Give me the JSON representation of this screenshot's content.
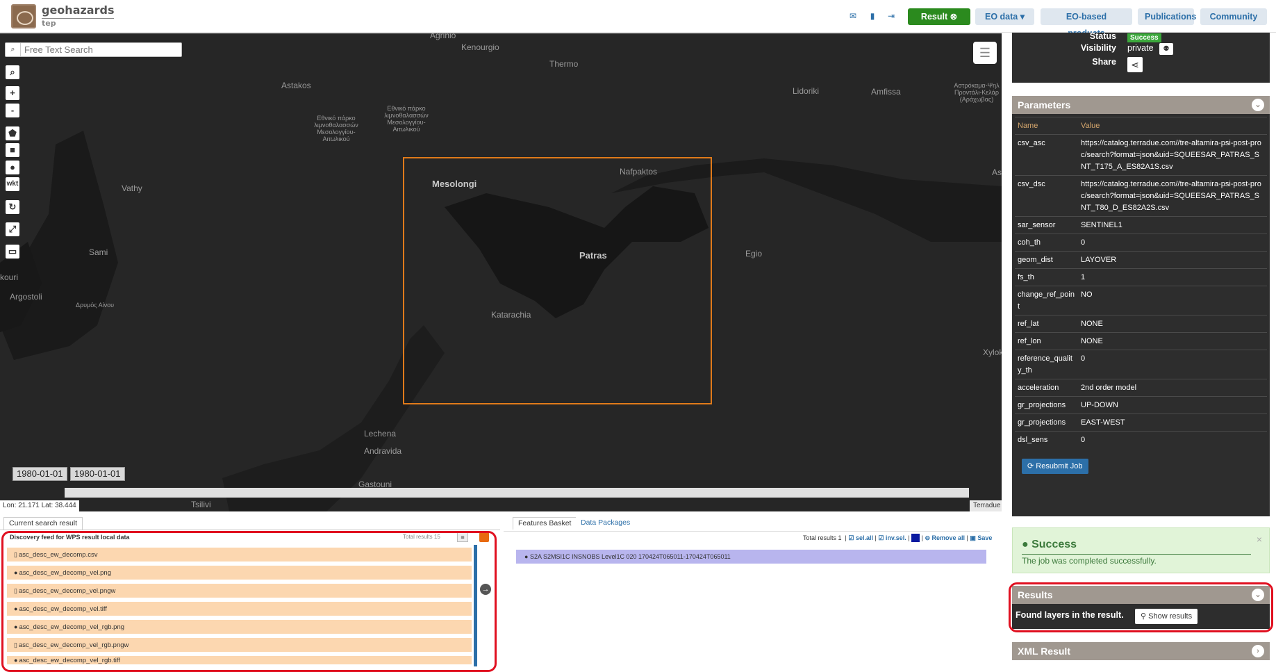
{
  "header": {
    "app_name": "geohazards",
    "app_sub": "tep",
    "icons": [
      "envelope-icon",
      "book-icon",
      "sign-out-icon"
    ],
    "nav": [
      {
        "label": "Result ⊗"
      },
      {
        "label": "EO data ▾"
      },
      {
        "label": "EO-based products"
      },
      {
        "label": "Publications"
      },
      {
        "label": "Community"
      }
    ]
  },
  "map": {
    "search_placeholder": "Free Text Search",
    "buttons": {
      "zoom_in": "+",
      "zoom_out": "-",
      "wkt": "wkt"
    },
    "places": [
      {
        "name": "Agrinio"
      },
      {
        "name": "Kenourgio"
      },
      {
        "name": "Thermo"
      },
      {
        "name": "Astakos"
      },
      {
        "name": "Lidoriki"
      },
      {
        "name": "Amfissa"
      },
      {
        "name": "Εθνικό πάρκο λιμνοθαλασσών Μεσολογγίου-Αιτωλικού"
      },
      {
        "name": "Εθνικό πάρκο λιμνοθαλασσών Μεσολογγίου-Αιτωλικού"
      },
      {
        "name": "Αστρόκαμα-Ψηλ Προντάλι-Κελάρ (Αράχωβας)"
      },
      {
        "name": "Vathy"
      },
      {
        "name": "Mesolongi"
      },
      {
        "name": "Nafpaktos"
      },
      {
        "name": "Aspr"
      },
      {
        "name": "Patras"
      },
      {
        "name": "Egio"
      },
      {
        "name": "Sami"
      },
      {
        "name": "kouri"
      },
      {
        "name": "Argostoli"
      },
      {
        "name": "Δρυμός Αίνου"
      },
      {
        "name": "Katarachia"
      },
      {
        "name": "Xylok"
      },
      {
        "name": "Lechena"
      },
      {
        "name": "Andravida"
      },
      {
        "name": "Gastouni"
      },
      {
        "name": "Tsilivi"
      }
    ],
    "dates": [
      "1980-01-01",
      "1980-01-01"
    ],
    "coords": "Lon: 21.171 Lat: 38.444",
    "attribution": "Terradue"
  },
  "sidebar": {
    "status": {
      "status_label": "Status",
      "status_value": "Success",
      "visibility_label": "Visibility",
      "visibility_value": "private",
      "share_label": "Share"
    },
    "parameters": {
      "title": "Parameters",
      "col_name": "Name",
      "col_value": "Value",
      "rows": [
        {
          "k": "csv_asc",
          "v": "https://catalog.terradue.com//tre-altamira-psi-post-proc/search?format=json&uid=SQUEESAR_PATRAS_SNT_T175_A_ES82A1S.csv"
        },
        {
          "k": "csv_dsc",
          "v": "https://catalog.terradue.com//tre-altamira-psi-post-proc/search?format=json&uid=SQUEESAR_PATRAS_SNT_T80_D_ES82A2S.csv"
        },
        {
          "k": "sar_sensor",
          "v": "SENTINEL1"
        },
        {
          "k": "coh_th",
          "v": "0"
        },
        {
          "k": "geom_dist",
          "v": "LAYOVER"
        },
        {
          "k": "fs_th",
          "v": "1"
        },
        {
          "k": "change_ref_point",
          "v": "NO"
        },
        {
          "k": "ref_lat",
          "v": "NONE"
        },
        {
          "k": "ref_lon",
          "v": "NONE"
        },
        {
          "k": "reference_quality_th",
          "v": "0"
        },
        {
          "k": "acceleration",
          "v": "2nd order model"
        },
        {
          "k": "gr_projections",
          "v": "UP-DOWN"
        },
        {
          "k": "gr_projections",
          "v": "EAST-WEST"
        },
        {
          "k": "dsl_sens",
          "v": "0"
        }
      ],
      "resubmit": "Resubmit Job"
    },
    "alert": {
      "title": "Success",
      "message": "The job was completed successfully.",
      "close": "×"
    },
    "results": {
      "title": "Results",
      "text": "Found layers in the result.",
      "button": "Show results"
    },
    "xml": {
      "title": "XML Result"
    }
  },
  "bottom": {
    "tab_current": "Current search result",
    "feed_title": "Discovery feed for WPS result local data",
    "total_results_left": "Total results 15",
    "files": [
      {
        "name": "asc_desc_ew_decomp.csv",
        "icon": "file-icon"
      },
      {
        "name": "asc_desc_ew_decomp_vel.png",
        "icon": "globe-icon"
      },
      {
        "name": "asc_desc_ew_decomp_vel.pngw",
        "icon": "file-icon"
      },
      {
        "name": "asc_desc_ew_decomp_vel.tiff",
        "icon": "globe-icon"
      },
      {
        "name": "asc_desc_ew_decomp_vel_rgb.png",
        "icon": "globe-icon"
      },
      {
        "name": "asc_desc_ew_decomp_vel_rgb.pngw",
        "icon": "file-icon"
      },
      {
        "name": "asc_desc_ew_decomp_vel_rgb.tiff",
        "icon": "globe-icon"
      }
    ],
    "tab_basket": "Features Basket",
    "tab_packages": "Data Packages",
    "total_results_right": "Total results  1",
    "tools": {
      "selall": "sel.all",
      "invsel": "inv.sel.",
      "remove": "Remove all",
      "save": "Save"
    },
    "feature": "S2A S2MSI1C INSNOBS Level1C 020 170424T065011-170424T065011"
  }
}
